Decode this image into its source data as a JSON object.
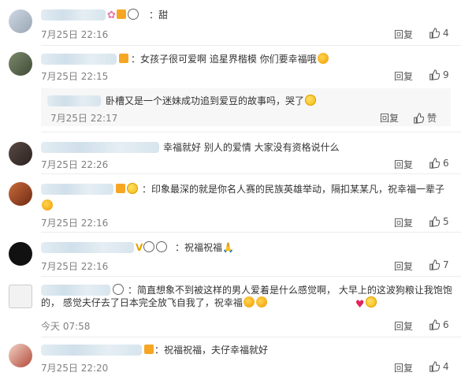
{
  "comments": [
    {
      "text": "：甜",
      "time": "7月25日 22:16",
      "reply": "回复",
      "likes": "4"
    },
    {
      "text": "：女孩子很可爱啊  追星界楷模   你们要幸福哦",
      "time": "7月25日 22:15",
      "reply": "回复",
      "likes": "9"
    },
    {
      "text": "卧槽又是一个迷妹成功追到爱豆的故事吗，哭了",
      "time": "7月25日 22:17",
      "reply": "回复",
      "likes": "赞"
    },
    {
      "text": "幸福就好 别人的爱情 大家没有资格说什么",
      "time": "7月25日 22:26",
      "reply": "回复",
      "likes": "6"
    },
    {
      "text": "：印象最深的就是你名人赛的民族英雄举动，隔扣某某凡，祝幸福一辈子",
      "time": "7月25日 22:16",
      "reply": "回复",
      "likes": "5"
    },
    {
      "text": "：祝福祝福",
      "time": "7月25日 22:16",
      "reply": "回复",
      "likes": "7"
    },
    {
      "text": "：简直想象不到被这样的男人爱着是什么感觉啊， 大早上的这波狗粮让我饱饱的， 感觉夫仔去了日本完全放飞自我了，祝幸福",
      "time": "今天 07:58",
      "reply": "回复",
      "likes": "6"
    },
    {
      "text": "：祝福祝福，夫仔幸福就好",
      "time": "7月25日 22:20",
      "reply": "回复",
      "likes": "4"
    }
  ],
  "icons": {
    "like": "thumbs-up-icon",
    "emoji_smile": "smile-emoji",
    "emoji_panda": "panda-emoji",
    "emoji_kiss": "kiss-emoji",
    "emoji_heart": "heart-emoji",
    "badge": "member-badge-icon"
  }
}
